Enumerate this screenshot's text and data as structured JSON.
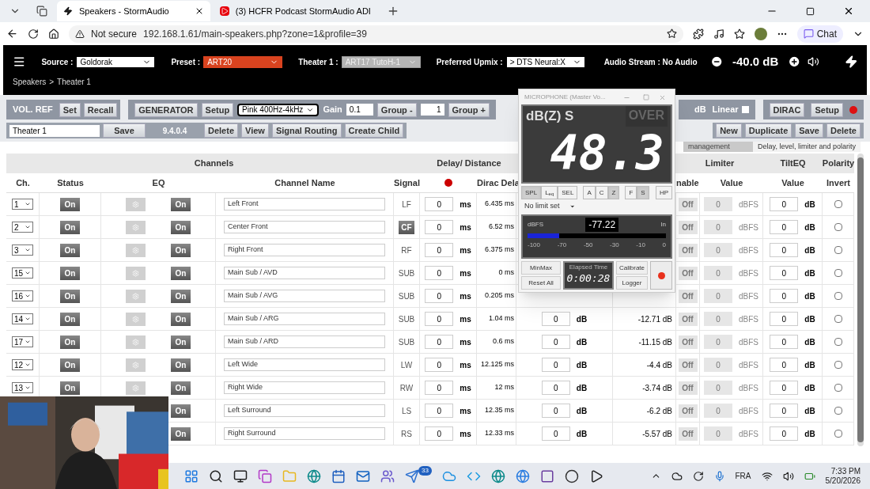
{
  "browser": {
    "tabs": [
      {
        "title": "Speakers - StormAudio",
        "kind": "bolt",
        "selected": true
      },
      {
        "title": "(3) HCFR Podcast StormAudio ADI",
        "kind": "video",
        "selected": false
      }
    ],
    "security": "Not secure",
    "url": "192.168.1.61/main-speakers.php?zone=1&profile=39",
    "chat": "Chat"
  },
  "header": {
    "selects": [
      {
        "label": "Source :",
        "value": "Goldorak",
        "kind": "normal",
        "disabled": false
      },
      {
        "label": "Preset :",
        "value": "ART20",
        "kind": "alert",
        "disabled": false
      },
      {
        "label": "Theater 1 :",
        "value": "ART17 TutoH-1",
        "kind": "normal",
        "disabled": true
      },
      {
        "label": "Preferred Upmix :",
        "value": "> DTS Neural:X",
        "kind": "normal",
        "disabled": false
      }
    ],
    "stream": "Audio Stream : No Audio",
    "volume": "-40.0 dB"
  },
  "breadcrumb": [
    "Speakers",
    ">",
    "Theater 1"
  ],
  "toolbar": {
    "vol_ref": "VOL. REF",
    "vol_buttons": [
      "Set",
      "Recall"
    ],
    "generator": "GENERATOR",
    "setup": "Setup",
    "signal": "Pink 400Hz-4kHz",
    "gain_label": "Gain",
    "gain": "0.1",
    "group_minus": "Group -",
    "group": "1",
    "group_plus": "Group +",
    "right_unit": "dB",
    "linear": {
      "label": "Linear",
      "checked": false
    },
    "dirac": "DIRAC",
    "dirac_setup": "Setup",
    "profile_name": "Theater 1",
    "profile_buttons_left": [
      "Save"
    ],
    "version": "9.4.0.4",
    "profile_buttons_mid": [
      "Delete",
      "View",
      "Signal Routing",
      "Create Child"
    ],
    "profile_buttons_right": [
      "New",
      "Duplicate",
      "Save",
      "Delete"
    ]
  },
  "view_tabs": [
    {
      "label": "management",
      "selected": false
    },
    {
      "label": "Delay, level, limiter and polarity",
      "selected": true
    }
  ],
  "table": {
    "groups": [
      "Channels",
      "Delay/ Distance",
      "Limiter",
      "TiltEQ",
      "Polarity"
    ],
    "columns": [
      "Ch.",
      "Status",
      "EQ",
      "Channel Name",
      "Signal",
      "Dirac Dela",
      "nable",
      "Value",
      "Value",
      "Invert"
    ],
    "rows": [
      {
        "ch": "1",
        "status": {
          "label": "On",
          "on": true
        },
        "eq": {
          "label": "On",
          "on": true
        },
        "name": "Left Front",
        "signal": {
          "text": "LF",
          "selected": false
        },
        "delay": "0",
        "delay_unit": "ms",
        "dirac_delay": "6.435 ms",
        "limiter": {
          "label": "Off",
          "disabled": true
        },
        "limiter_value": "0",
        "limiter_unit": "dBFS",
        "tilt": "0",
        "tilt_unit": "dB",
        "invert": false
      },
      {
        "ch": "2",
        "status": {
          "label": "On",
          "on": true
        },
        "eq": {
          "label": "On",
          "on": true
        },
        "name": "Center Front",
        "signal": {
          "text": "CF",
          "selected": true
        },
        "delay": "0",
        "delay_unit": "ms",
        "dirac_delay": "6.52 ms",
        "limiter": {
          "label": "Off",
          "disabled": true
        },
        "limiter_value": "0",
        "limiter_unit": "dBFS",
        "tilt": "0",
        "tilt_unit": "dB",
        "invert": false
      },
      {
        "ch": "3",
        "status": {
          "label": "On",
          "on": true
        },
        "eq": {
          "label": "On",
          "on": true
        },
        "name": "Right Front",
        "signal": {
          "text": "RF",
          "selected": false
        },
        "delay": "0",
        "delay_unit": "ms",
        "dirac_delay": "6.375 ms",
        "limiter": {
          "label": "Off",
          "disabled": true
        },
        "limiter_value": "0",
        "limiter_unit": "dBFS",
        "tilt": "0",
        "tilt_unit": "dB",
        "invert": false
      },
      {
        "ch": "15",
        "status": {
          "label": "On",
          "on": true
        },
        "eq": {
          "label": "On",
          "on": true
        },
        "name": "Main Sub / AVD",
        "signal": {
          "text": "SUB",
          "selected": false
        },
        "delay": "0",
        "delay_unit": "ms",
        "dirac_delay": "0 ms",
        "limiter": {
          "label": "Off",
          "disabled": true
        },
        "limiter_value": "0",
        "limiter_unit": "dBFS",
        "tilt": "0",
        "tilt_unit": "dB",
        "invert": false
      },
      {
        "ch": "16",
        "status": {
          "label": "On",
          "on": true
        },
        "eq": {
          "label": "On",
          "on": true
        },
        "name": "Main Sub / AVG",
        "signal": {
          "text": "SUB",
          "selected": false
        },
        "delay": "0",
        "delay_unit": "ms",
        "dirac_delay": "0.205 ms",
        "limiter": {
          "label": "Off",
          "disabled": true
        },
        "limiter_value": "0",
        "limiter_unit": "dBFS",
        "tilt": "0",
        "tilt_unit": "dB",
        "invert": false
      },
      {
        "ch": "14",
        "status": {
          "label": "On",
          "on": true
        },
        "eq": {
          "label": "On",
          "on": true
        },
        "name": "Main Sub / ARG",
        "signal": {
          "text": "SUB",
          "selected": false
        },
        "delay": "0",
        "delay_unit": "ms",
        "dirac_delay": "1.04 ms",
        "gain": "0",
        "gain_unit": "dB",
        "level": "-12.71 dB",
        "limiter": {
          "label": "Off",
          "disabled": true
        },
        "limiter_value": "0",
        "limiter_unit": "dBFS",
        "tilt": "0",
        "tilt_unit": "dB",
        "invert": false
      },
      {
        "ch": "17",
        "status": {
          "label": "On",
          "on": true
        },
        "eq": {
          "label": "On",
          "on": true
        },
        "name": "Main Sub / ARD",
        "signal": {
          "text": "SUB",
          "selected": false
        },
        "delay": "0",
        "delay_unit": "ms",
        "dirac_delay": "0.6 ms",
        "gain": "0",
        "gain_unit": "dB",
        "level": "-11.15 dB",
        "limiter": {
          "label": "Off",
          "disabled": true
        },
        "limiter_value": "0",
        "limiter_unit": "dBFS",
        "tilt": "0",
        "tilt_unit": "dB",
        "invert": false
      },
      {
        "ch": "12",
        "status": {
          "label": "On",
          "on": true
        },
        "eq": {
          "label": "On",
          "on": true
        },
        "name": "Left Wide",
        "signal": {
          "text": "LW",
          "selected": false
        },
        "delay": "0",
        "delay_unit": "ms",
        "dirac_delay": "12.125 ms",
        "gain": "0",
        "gain_unit": "dB",
        "level": "-4.4 dB",
        "limiter": {
          "label": "Off",
          "disabled": true
        },
        "limiter_value": "0",
        "limiter_unit": "dBFS",
        "tilt": "0",
        "tilt_unit": "dB",
        "invert": false
      },
      {
        "ch": "13",
        "status": {
          "label": "On",
          "on": true
        },
        "eq": {
          "label": "On",
          "on": true
        },
        "name": "Right Wide",
        "signal": {
          "text": "RW",
          "selected": false
        },
        "delay": "0",
        "delay_unit": "ms",
        "dirac_delay": "12 ms",
        "gain": "0",
        "gain_unit": "dB",
        "level": "-3.74 dB",
        "limiter": {
          "label": "Off",
          "disabled": true
        },
        "limiter_value": "0",
        "limiter_unit": "dBFS",
        "tilt": "0",
        "tilt_unit": "dB",
        "invert": false
      },
      {
        "eq": {
          "label": "On",
          "on": true
        },
        "name": "Left Surround",
        "signal": {
          "text": "LS",
          "selected": false
        },
        "delay": "0",
        "delay_unit": "ms",
        "dirac_delay": "12.35 ms",
        "gain": "0",
        "gain_unit": "dB",
        "level": "-6.2 dB",
        "limiter": {
          "label": "Off",
          "disabled": true
        },
        "limiter_value": "0",
        "limiter_unit": "dBFS",
        "tilt": "0",
        "tilt_unit": "dB",
        "invert": false
      },
      {
        "eq": {
          "label": "On",
          "on": true
        },
        "name": "Right Surround",
        "signal": {
          "text": "RS",
          "selected": false
        },
        "delay": "0",
        "delay_unit": "ms",
        "dirac_delay": "12.33 ms",
        "gain": "0",
        "gain_unit": "dB",
        "level": "-5.57 dB",
        "limiter": {
          "label": "Off",
          "disabled": true
        },
        "limiter_value": "0",
        "limiter_unit": "dBFS",
        "tilt": "0",
        "tilt_unit": "dB",
        "invert": false
      }
    ]
  },
  "meter_window": {
    "title": "MICROPHONE (Master Vo...",
    "mode_label": "dB(Z) S",
    "over": "OVER",
    "reading": "48.3",
    "modes": [
      {
        "label": "SPL",
        "selected": true
      },
      {
        "label": "L$_{eq}$",
        "selected": false
      },
      {
        "label": "SEL",
        "selected": false
      }
    ],
    "weightings": [
      {
        "label": "A",
        "selected": false
      },
      {
        "label": "C",
        "selected": false
      },
      {
        "label": "Z",
        "selected": true
      }
    ],
    "speeds": [
      {
        "label": "F",
        "selected": false
      },
      {
        "label": "S",
        "selected": true
      }
    ],
    "hp": {
      "label": "HP",
      "selected": false
    },
    "limit": "No limit set",
    "input_meter": {
      "unit": "dBFS",
      "reading": "-77.22",
      "source": "In",
      "level": 0.23,
      "scale": [
        "-100",
        "-70",
        "-50",
        "-30",
        "-10",
        "0"
      ]
    },
    "left_buttons": [
      "MinMax",
      "Reset All"
    ],
    "elapsed_label": "Elapsed Time",
    "elapsed": "0:00:28",
    "right_buttons": [
      "Calibrate",
      "Logger"
    ],
    "recording": true
  },
  "webcam": {
    "kind": "picture"
  },
  "taskbar": {
    "badge": "33",
    "language": "FRA",
    "time": "7:33 PM",
    "date": "5/20/2026"
  }
}
